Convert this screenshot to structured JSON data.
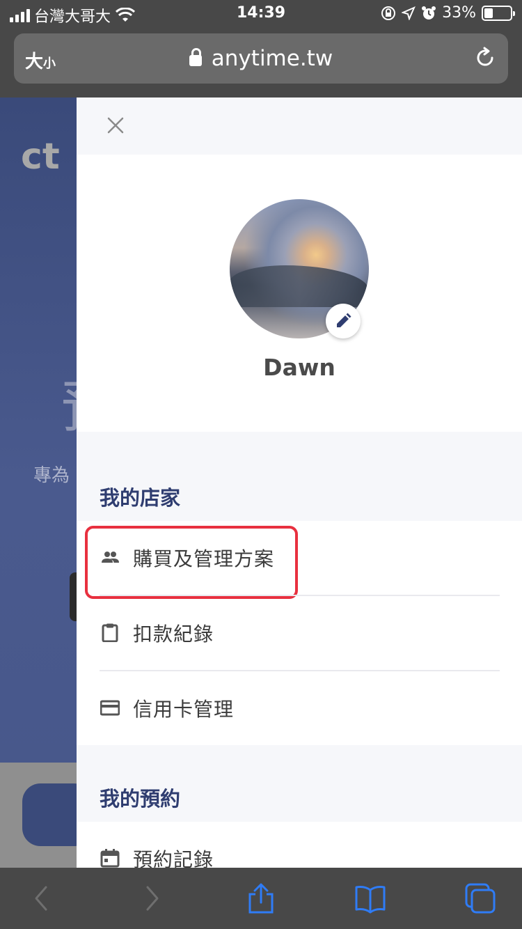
{
  "status_bar": {
    "carrier": "台灣大哥大",
    "time": "14:39",
    "battery": "33%",
    "battery_level": 0.33
  },
  "browser": {
    "text_size_label": "大",
    "text_size_small": "小",
    "url": "anytime.tw"
  },
  "background_page": {
    "logo_text": "ct",
    "headline_partial": "預",
    "subtitle_partial": "專為"
  },
  "drawer": {
    "user_name": "Dawn",
    "sections": [
      {
        "title": "我的店家",
        "items": [
          {
            "label": "購買及管理方案",
            "icon": "people-icon",
            "highlighted": true
          },
          {
            "label": "扣款紀錄",
            "icon": "clipboard-icon"
          },
          {
            "label": "信用卡管理",
            "icon": "credit-card-icon"
          }
        ]
      },
      {
        "title": "我的預約",
        "items": [
          {
            "label": "預約記錄",
            "icon": "calendar-icon"
          }
        ]
      }
    ]
  },
  "colors": {
    "accent": "#2f3d70",
    "highlight": "#e8303f",
    "ios_blue": "#2f7cf6"
  }
}
